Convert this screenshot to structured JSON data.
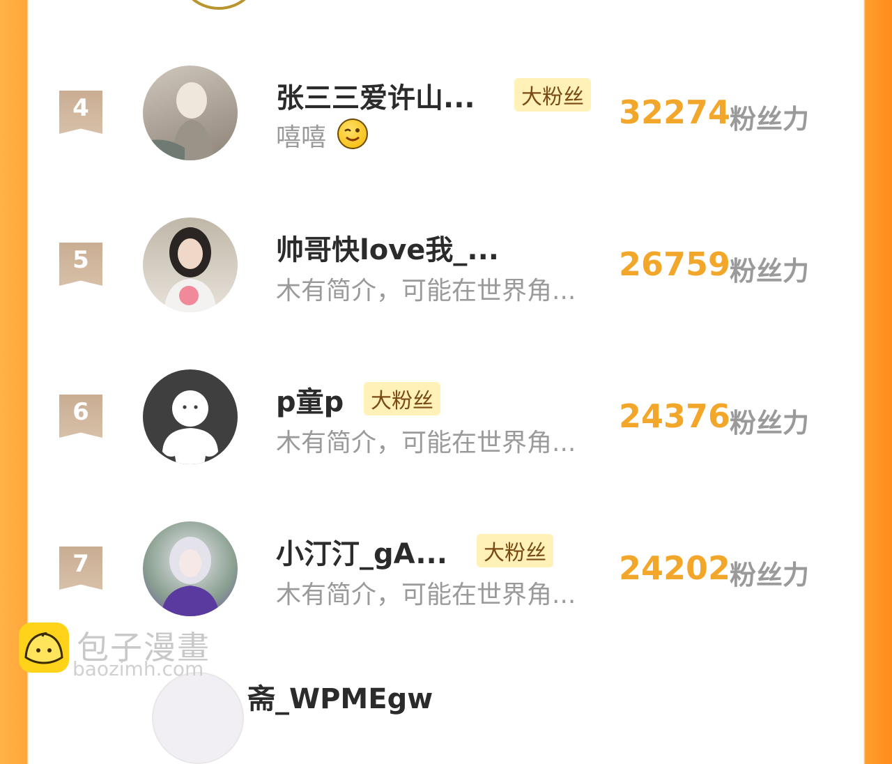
{
  "rows": [
    {
      "rank": "4",
      "name": "张三三爱许山...",
      "tag": "大粉丝",
      "bio": "嘻嘻",
      "score": "32274",
      "unit": "粉丝力"
    },
    {
      "rank": "5",
      "name": "帅哥快love我_...",
      "tag": "",
      "bio": "木有简介，可能在世界角...",
      "score": "26759",
      "unit": "粉丝力"
    },
    {
      "rank": "6",
      "name": "p童p",
      "tag": "大粉丝",
      "bio": "木有简介，可能在世界角...",
      "score": "24376",
      "unit": "粉丝力"
    },
    {
      "rank": "7",
      "name": "小汀汀_gA...",
      "tag": "大粉丝",
      "bio": "木有简介，可能在世界角...",
      "score": "24202",
      "unit": "粉丝力"
    }
  ],
  "partial_row": {
    "name": "斋_WPMEgw"
  },
  "watermark": {
    "cn": "包子漫畫",
    "en": "baozimh.com"
  }
}
